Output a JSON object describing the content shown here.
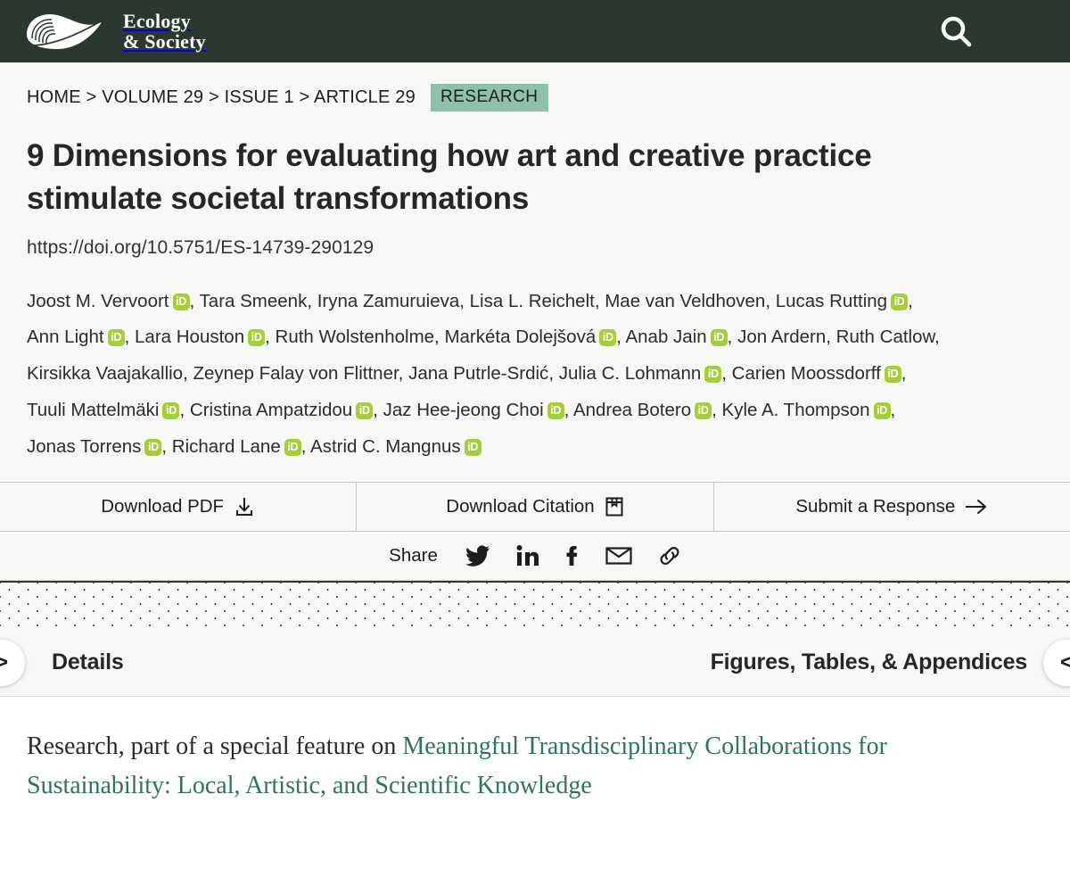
{
  "header": {
    "brand_line1": "Ecology",
    "brand_line2": "& Society",
    "search_label": "search-icon",
    "menu_label": "menu-icon"
  },
  "breadcrumb": {
    "trail": "HOME > VOLUME 29 > ISSUE 1 > ARTICLE 29",
    "badge": "RESEARCH"
  },
  "article": {
    "title": "9 Dimensions for evaluating how art and creative practice stimulate societal transformations",
    "doi": "https://doi.org/10.5751/ES-14739-290129"
  },
  "authors": [
    {
      "name": "Joost M. Vervoort",
      "orcid": true
    },
    {
      "name": "Tara Smeenk",
      "orcid": false
    },
    {
      "name": "Iryna Zamuruieva",
      "orcid": false
    },
    {
      "name": "Lisa L. Reichelt",
      "orcid": false
    },
    {
      "name": "Mae van Veldhoven",
      "orcid": false
    },
    {
      "name": "Lucas Rutting",
      "orcid": true
    },
    {
      "name": "Ann Light",
      "orcid": true
    },
    {
      "name": "Lara Houston",
      "orcid": true
    },
    {
      "name": "Ruth Wolstenholme",
      "orcid": false
    },
    {
      "name": "Markéta Dolejšová",
      "orcid": true
    },
    {
      "name": "Anab Jain",
      "orcid": true
    },
    {
      "name": "Jon Ardern",
      "orcid": false
    },
    {
      "name": "Ruth Catlow",
      "orcid": false
    },
    {
      "name": "Kirsikka Vaajakallio",
      "orcid": false
    },
    {
      "name": "Zeynep Falay von Flittner",
      "orcid": false
    },
    {
      "name": "Jana Putrle-Srdić",
      "orcid": false
    },
    {
      "name": "Julia C. Lohmann",
      "orcid": true
    },
    {
      "name": "Carien Moossdorff",
      "orcid": true
    },
    {
      "name": "Tuuli Mattelmäki",
      "orcid": true
    },
    {
      "name": "Cristina Ampatzidou",
      "orcid": true
    },
    {
      "name": "Jaz Hee-jeong Choi",
      "orcid": true
    },
    {
      "name": "Andrea Botero",
      "orcid": true
    },
    {
      "name": "Kyle A. Thompson",
      "orcid": true
    },
    {
      "name": "Jonas Torrens",
      "orcid": true
    },
    {
      "name": "Richard Lane",
      "orcid": true
    },
    {
      "name": "Astrid C. Mangnus",
      "orcid": true
    }
  ],
  "orcid_glyph": "iD",
  "actions": [
    {
      "label": "Download PDF",
      "icon": "download-icon"
    },
    {
      "label": "Download Citation",
      "icon": "citation-icon"
    },
    {
      "label": "Submit a Response",
      "icon": "arrow-right-icon"
    }
  ],
  "share": {
    "label": "Share",
    "items": [
      "twitter-icon",
      "linkedin-icon",
      "facebook-icon",
      "email-icon",
      "link-icon"
    ]
  },
  "tabs": {
    "prev_chevron": ">",
    "next_chevron": "<",
    "details": "Details",
    "figures": "Figures, Tables, & Appendices"
  },
  "special_feature": {
    "prefix": "Research, part of a special feature on ",
    "link": "Meaningful Transdisciplinary Collaborations for Sustainability: Local, Artistic, and Scientific Knowledge"
  },
  "colors": {
    "header_bg": "#2b372f",
    "badge_bg": "#8fc0ac",
    "orcid_green": "#a6ce39",
    "link_green": "#2e7360",
    "page_bg": "#f7f7f5"
  }
}
